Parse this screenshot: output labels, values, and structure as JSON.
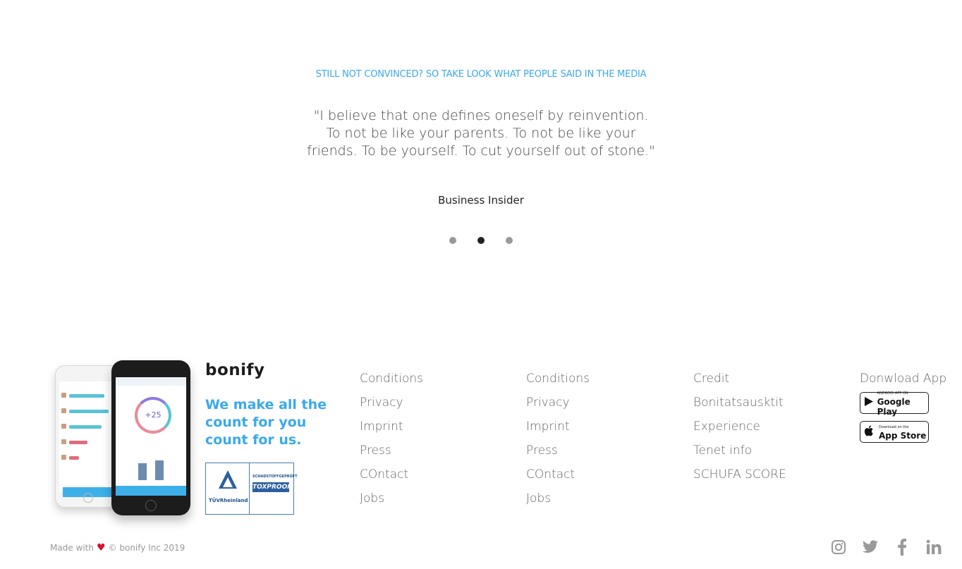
{
  "media": {
    "eyebrow": "STILL NOT CONVINCED? SO TAKE LOOK WHAT PEOPLE SAID IN THE MEDIA",
    "quote": "\"I believe that one defines oneself by reinvention. To not be like your parents. To not be like your friends. To be yourself. To cut yourself out of stone.\"",
    "source": "Business Insider",
    "active_slide": 2,
    "slide_count": 3
  },
  "brand": {
    "logo": "bonify",
    "tagline": "We make all the count for you count for us.",
    "seal_left": "TÜVRheinland",
    "seal_right_top": "SCHADSTOFFGEPRÜFT",
    "seal_right_badge": "TOXPROOF",
    "phone_score": "+25"
  },
  "footer": {
    "col1": [
      "Conditions",
      "Privacy",
      "Imprint",
      "Press",
      "COntact",
      "Jobs"
    ],
    "col2": [
      "Conditions",
      "Privacy",
      "Imprint",
      "Press",
      "COntact",
      "Jobs"
    ],
    "col3": [
      "Credit",
      "Bonitatsausktit",
      "Experience",
      "Tenet info",
      "SCHUFA SCORE"
    ],
    "app": {
      "title": "Donwload App",
      "google_small": "ANDROID APP ON",
      "google_big": "Google Play",
      "apple_small": "Download on the",
      "apple_big": "App Store"
    },
    "made_with": "Made with",
    "copyright": "© bonify Inc 2019",
    "social": [
      "instagram-icon",
      "twitter-icon",
      "facebook-icon",
      "linkedin-icon"
    ]
  },
  "colors": {
    "accent": "#3aa9ea",
    "heart": "#d8132f"
  }
}
